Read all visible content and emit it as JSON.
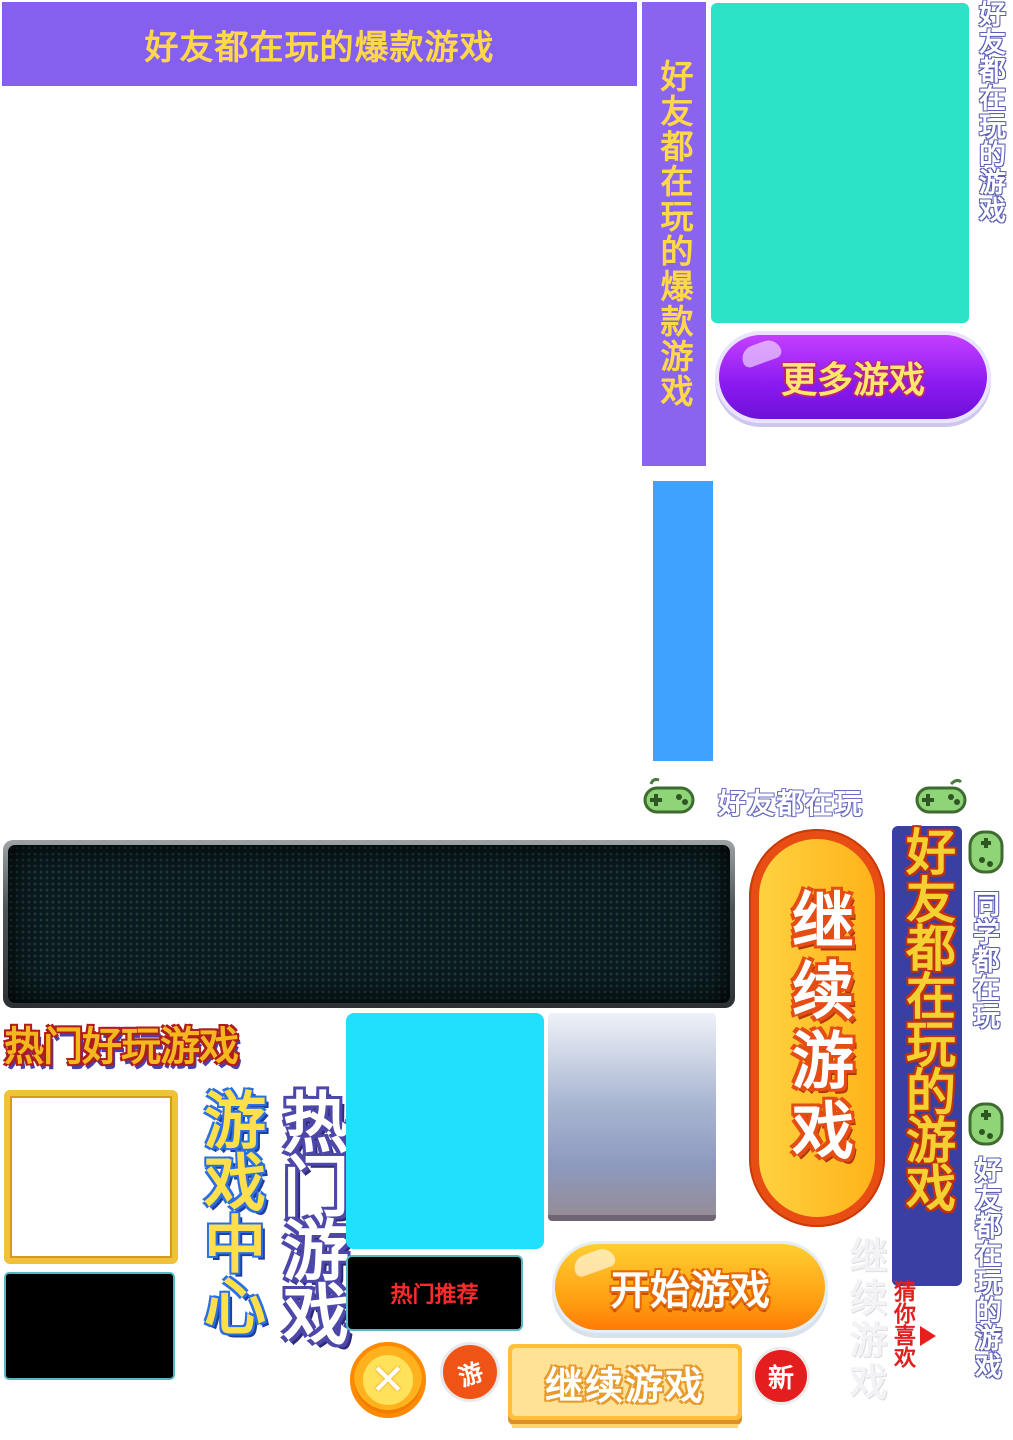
{
  "banners": {
    "top_title": "好友都在玩的爆款游戏",
    "vertical_title": "好友都在玩的爆款游戏",
    "vertical_outline_1": "好友都在玩的游戏",
    "vertical_outline_2": "好友都在玩的游戏"
  },
  "buttons": {
    "more_games": "更多游戏",
    "start_game": "开始游戏",
    "continue_game": "继续游戏",
    "close_symbol": "✕"
  },
  "labels": {
    "friends_playing": "好友都在玩",
    "continue_vertical": "继续游戏",
    "friends_games_vertical": "好友都在玩的游戏",
    "classmates_playing": "同学都在玩",
    "guess_you_like": "猜你喜欢",
    "ghost_continue": "继续游戏",
    "hot_fun_games": "热门好玩游戏",
    "game_center": "游戏中心",
    "hot_games": "热门游戏",
    "hot_recommend": "热门推荐"
  },
  "badges": {
    "you": "游",
    "new": "新"
  },
  "icons": [
    "gamepad-icon",
    "close-icon",
    "play-arrow-icon"
  ],
  "colors": {
    "purple": "#8560ef",
    "teal": "#2be2c7",
    "blue": "#3fa2ff",
    "cyan": "#20e0fe",
    "orange": "#ff9b10",
    "red": "#e41e1e",
    "yellow": "#ffd84a"
  }
}
